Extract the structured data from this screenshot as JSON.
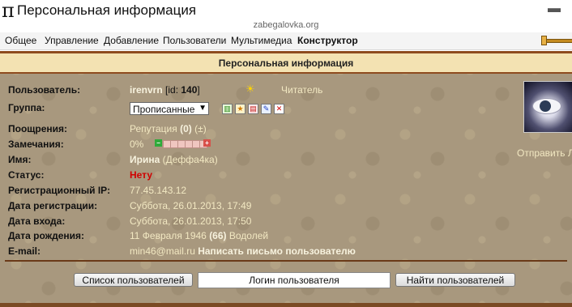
{
  "window": {
    "title": "Персональная информация",
    "url": "zabegalovka.org"
  },
  "menu": [
    "Общее",
    "Управление",
    "Добавление",
    "Пользователи",
    "Мультимедиа",
    "Конструктор"
  ],
  "panel": {
    "header": "Персональная информация",
    "user": {
      "label": "Пользователь:",
      "name": "irenvrn",
      "id_prefix": "[id: ",
      "id": "140",
      "id_suffix": "]",
      "role": "Читатель"
    },
    "group": {
      "label": "Группа:",
      "selected": "Прописанные"
    },
    "rewards": {
      "label": "Поощрения:",
      "text": "Репутация",
      "count": "(0)",
      "action": "(±)"
    },
    "warnings": {
      "label": "Замечания:",
      "percent": "0%"
    },
    "name": {
      "label": "Имя:",
      "first": "Ирина",
      "nick": "(Деффа4ка)"
    },
    "status": {
      "label": "Статус:",
      "value": "Нету"
    },
    "reg_ip": {
      "label": "Регистрационный IP:",
      "value": "77.45.143.12"
    },
    "reg_date": {
      "label": "Дата регистрации:",
      "value": "Суббота, 26.01.2013, 17:49"
    },
    "login_date": {
      "label": "Дата входа:",
      "value": "Суббота, 26.01.2013, 17:50"
    },
    "birth": {
      "label": "Дата рождения:",
      "date": "11 Февраля 1946",
      "age": "(66)",
      "sign": "Водолей"
    },
    "email": {
      "label": "E-mail:",
      "value": "min46@mail.ru",
      "action": "Написать письмо пользователю"
    },
    "send_link": "Отправить Л"
  },
  "footer": {
    "list_button": "Список пользователей",
    "login_value": "Логин пользователя",
    "find_button": "Найти пользователей"
  },
  "colors": {
    "panel_bg": "#a8987e",
    "header_bg": "#f3e2b2",
    "border": "#8e4b1e",
    "value_text": "#f2e8c2",
    "status_red": "#d00000"
  }
}
